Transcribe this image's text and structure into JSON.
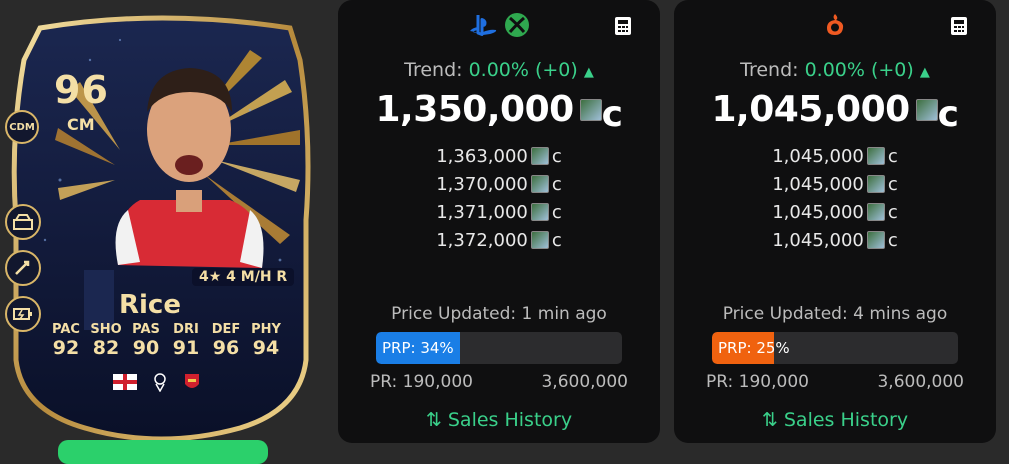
{
  "card": {
    "rating": "96",
    "position": "CM",
    "position_badge": "CDM",
    "skills": "4★ 4 M/H R",
    "name": "Rice",
    "stat_labels": [
      "PAC",
      "SHO",
      "PAS",
      "DRI",
      "DEF",
      "PHY"
    ],
    "stat_values": [
      "92",
      "82",
      "90",
      "91",
      "96",
      "94"
    ],
    "playstyle_icons": [
      "wall-playstyle-icon",
      "intercept-playstyle-icon",
      "relentless-playstyle-icon"
    ],
    "nation_icon": "england-flag-icon",
    "league_icon": "premier-league-icon",
    "club_icon": "arsenal-crest-icon"
  },
  "panels": [
    {
      "platform_icons": [
        "playstation-icon",
        "xbox-icon"
      ],
      "calculator_icon": "calculator-icon",
      "trend_label": "Trend:",
      "trend_value": "0.00% (+0)",
      "trend_arrow": "▲",
      "main_bin": "1,350,000",
      "coin_suffix": "c",
      "bins": [
        "1,363,000",
        "1,370,000",
        "1,371,000",
        "1,372,000"
      ],
      "updated": "Price Updated: 1 min ago",
      "prp_label": "PRP: 34%",
      "prp_percent": 34,
      "prp_color": "#1a7ee6",
      "pr_min": "PR: 190,000",
      "pr_max": "3,600,000",
      "sales_label": "Sales History"
    },
    {
      "platform_icons": [
        "origin-pc-icon"
      ],
      "calculator_icon": "calculator-icon",
      "trend_label": "Trend:",
      "trend_value": "0.00% (+0)",
      "trend_arrow": "▲",
      "main_bin": "1,045,000",
      "coin_suffix": "c",
      "bins": [
        "1,045,000",
        "1,045,000",
        "1,045,000",
        "1,045,000"
      ],
      "updated": "Price Updated: 4 mins ago",
      "prp_label": "PRP: 25%",
      "prp_percent": 25,
      "prp_color": "#f0620f",
      "pr_min": "PR: 190,000",
      "pr_max": "3,600,000",
      "sales_label": "Sales History"
    }
  ],
  "colors": {
    "accent_green": "#3ad08a",
    "card_gold": "#f4dfa6",
    "panel_bg": "#0f0f10"
  }
}
